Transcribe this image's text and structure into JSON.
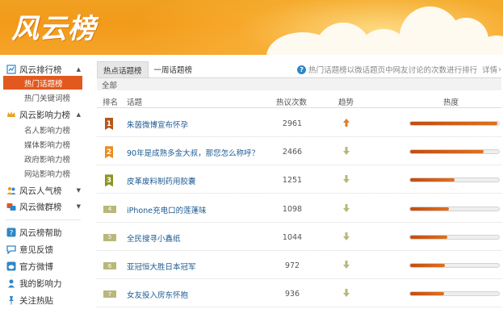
{
  "header": {
    "logo_text": "风云榜"
  },
  "sidebar": {
    "groups": [
      {
        "label": "风云排行榜",
        "icon": "ranking-icon"
      },
      {
        "label": "风云影响力榜",
        "icon": "crown-icon"
      },
      {
        "label": "风云人气榜",
        "icon": "people-icon"
      },
      {
        "label": "风云微群榜",
        "icon": "group-icon"
      }
    ],
    "subs": {
      "ranking": [
        "热门话题榜",
        "热门关键词榜"
      ],
      "influence": [
        "名人影响力榜",
        "媒体影响力榜",
        "政府影响力榜",
        "网站影响力榜"
      ]
    },
    "links": [
      {
        "label": "风云榜帮助",
        "icon": "help-icon"
      },
      {
        "label": "意见反馈",
        "icon": "feedback-icon"
      },
      {
        "label": "官方微博",
        "icon": "weibo-icon"
      },
      {
        "label": "我的影响力",
        "icon": "person-icon"
      },
      {
        "label": "关注热贴",
        "icon": "pin-icon"
      }
    ]
  },
  "main": {
    "tabs": [
      "热点话题榜",
      "一周话题榜"
    ],
    "notice": "热门话题榜以微话题页中网友讨论的次数进行排行",
    "notice_link": "详情",
    "filter": "全部",
    "columns": {
      "rank": "排名",
      "topic": "话题",
      "count": "热议次数",
      "trend": "趋势",
      "heat": "热度"
    }
  },
  "rows": [
    {
      "rank": "1",
      "topic": "朱茵微博宣布怀孕",
      "count": "2961",
      "trend": "up",
      "heat": 0.98,
      "rank_color": "#b5561c",
      "topic_color": "#1d5a92"
    },
    {
      "rank": "2",
      "topic": "90年是成熟多金大叔，那您怎么称呼？",
      "count": "2466",
      "trend": "down",
      "heat": 0.83,
      "rank_color": "#ee8c1c",
      "topic_color": "#1d5a92"
    },
    {
      "rank": "3",
      "topic": "皮革废料制药用胶囊",
      "count": "1251",
      "trend": "down",
      "heat": 0.5,
      "rank_color": "#8b9424",
      "topic_color": "#1d5a92"
    },
    {
      "rank": "4",
      "topic": "iPhone充电口的莲蓬味",
      "count": "1098",
      "trend": "down",
      "heat": 0.44,
      "rank_color": "#b9b77a",
      "topic_color": "#1d5a92"
    },
    {
      "rank": "5",
      "topic": "全民搜寻小鑫纸",
      "count": "1044",
      "trend": "down",
      "heat": 0.42,
      "rank_color": "#b9b77a",
      "topic_color": "#1d5a92"
    },
    {
      "rank": "6",
      "topic": "亚冠恒大胜日本冠军",
      "count": "972",
      "trend": "down",
      "heat": 0.39,
      "rank_color": "#b9b77a",
      "topic_color": "#1d5a92"
    },
    {
      "rank": "7",
      "topic": "女友投入房东怀抱",
      "count": "936",
      "trend": "down",
      "heat": 0.38,
      "rank_color": "#b9b77a",
      "topic_color": "#1d5a92"
    }
  ],
  "colors": {
    "accent": "#e1591f",
    "header": "#f39a1a",
    "link": "#1d5a92",
    "trend_up": "#e07d22",
    "trend_down": "#b9b77a"
  }
}
